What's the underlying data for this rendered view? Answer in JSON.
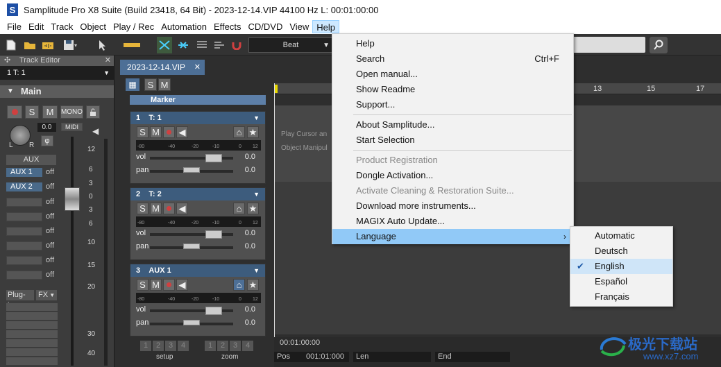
{
  "window": {
    "title": "Samplitude Pro X8 Suite (Build 23418, 64 Bit)  -  2023-12-14.VIP   44100 Hz L: 00:01:00:00"
  },
  "menubar": [
    "File",
    "Edit",
    "Track",
    "Object",
    "Play / Rec",
    "Automation",
    "Effects",
    "CD/DVD",
    "View",
    "Help"
  ],
  "toolbar": {
    "beat_label": "Beat"
  },
  "track_editor": {
    "title": "Track Editor",
    "track": "1  T: 1",
    "main_label": "Main",
    "volume_value": "0.0",
    "btn_s": "S",
    "btn_m": "M",
    "btn_mono": "MONO",
    "btn_midi": "MIDI",
    "aux_label": "AUX",
    "aux_sends": [
      {
        "label": "AUX  1",
        "state": "off"
      },
      {
        "label": "AUX  2",
        "state": "off"
      }
    ],
    "empty_states": [
      "off",
      "off",
      "off",
      "off",
      "off",
      "off"
    ],
    "plugins_label": "Plug-ins",
    "fx_label": "FX",
    "scale": [
      "12",
      "6",
      "3",
      "0",
      "3",
      "6",
      "10",
      "15",
      "20",
      "30",
      "40"
    ],
    "pan_l": "L",
    "pan_r": "R"
  },
  "project_tab": "2023-12-14.VIP",
  "marker_label": "Marker",
  "tracks": [
    {
      "number": "1",
      "name": "T: 1",
      "vol_label": "vol",
      "vol": "0.0",
      "pan_label": "pan",
      "pan": "0.0"
    },
    {
      "number": "2",
      "name": "T: 2",
      "vol_label": "vol",
      "vol": "0.0",
      "pan_label": "pan",
      "pan": "0.0"
    },
    {
      "number": "3",
      "name": "AUX  1",
      "vol_label": "vol",
      "vol": "0.0",
      "pan_label": "pan",
      "pan": "0.0"
    }
  ],
  "meter_scale": [
    "-80",
    "-40",
    "-20",
    "-10",
    "0",
    "12"
  ],
  "timeline": [
    "13",
    "15",
    "17"
  ],
  "hints": {
    "play_cursor": "Play Cursor an",
    "object_manip": "Object Manipul"
  },
  "transport": {
    "time": "00:01:00:00",
    "pos_label": "Pos",
    "pos_value": "001:01:000",
    "len_label": "Len",
    "end_label": "End",
    "setup_label": "setup",
    "zoom_label": "zoom",
    "nums": [
      "1",
      "2",
      "3",
      "4"
    ]
  },
  "help_menu": {
    "groups": [
      [
        {
          "label": "Help"
        },
        {
          "label": "Search",
          "shortcut": "Ctrl+F"
        },
        {
          "label": "Open manual..."
        },
        {
          "label": "Show Readme"
        },
        {
          "label": "Support..."
        }
      ],
      [
        {
          "label": "About Samplitude..."
        },
        {
          "label": "Start Selection"
        }
      ],
      [
        {
          "label": "Product Registration",
          "disabled": true
        },
        {
          "label": "Dongle Activation..."
        },
        {
          "label": "Activate Cleaning & Restoration Suite...",
          "disabled": true
        },
        {
          "label": "Download more instruments..."
        },
        {
          "label": "MAGIX Auto Update..."
        },
        {
          "label": "Language",
          "submenu": true
        }
      ]
    ]
  },
  "language_menu": {
    "items": [
      "Automatic",
      "Deutsch",
      "English",
      "Español",
      "Français"
    ],
    "selected": "English"
  },
  "watermark": {
    "text": "极光下载站",
    "url": "www.xz7.com"
  },
  "colors": {
    "accent": "#91c9f7",
    "track_header": "#3d5c7d",
    "record": "#d04040"
  }
}
